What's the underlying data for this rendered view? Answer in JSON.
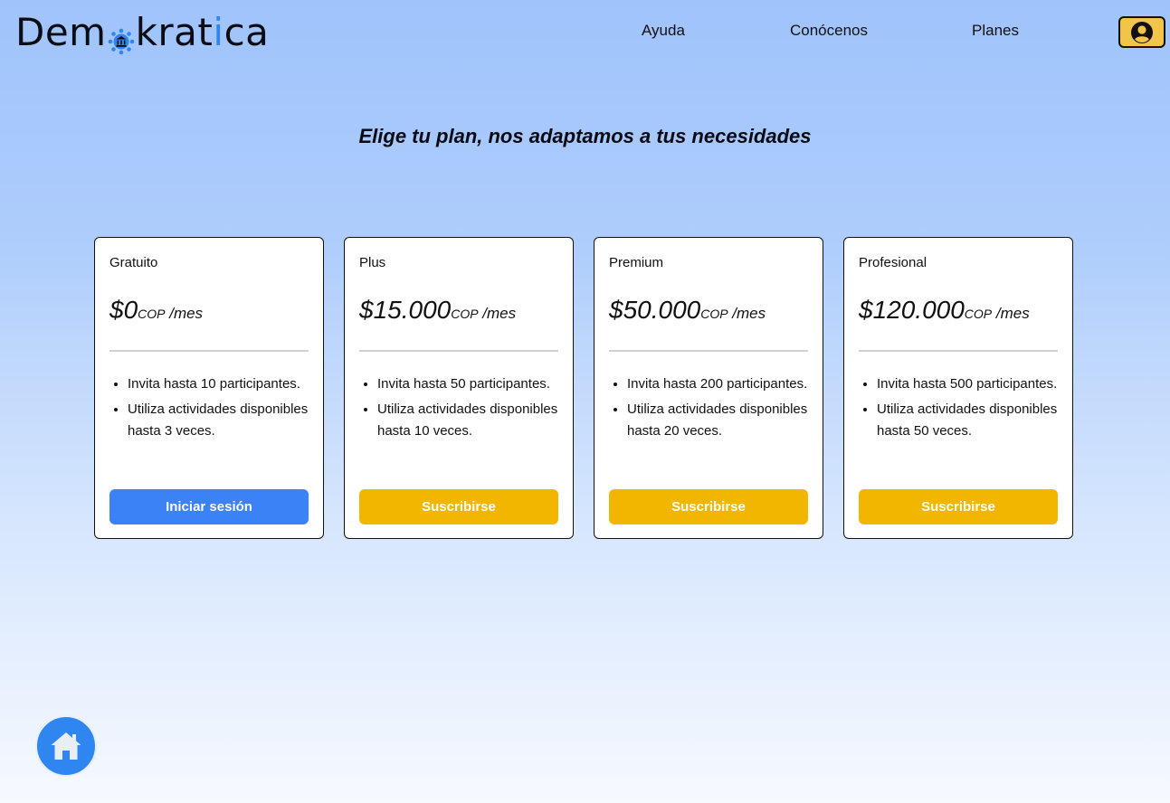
{
  "header": {
    "logo": {
      "part1": "Dem",
      "part2": "krat",
      "part3": "i",
      "part4": "ca"
    },
    "nav": [
      "Ayuda",
      "Conócenos",
      "Planes"
    ],
    "user_icon": "user-circle-icon"
  },
  "title": "Elige tu plan, nos adaptamos a tus necesidades",
  "plans": [
    {
      "name": "Gratuito",
      "price": "$0",
      "currency": "COP",
      "period": " /mes",
      "features": [
        "Invita hasta 10 participantes.",
        "Utiliza actividades disponibles hasta 3 veces."
      ],
      "button": "Iniciar sesión",
      "button_color": "#3b82f6"
    },
    {
      "name": "Plus",
      "price": "$15.000",
      "currency": "COP",
      "period": " /mes",
      "features": [
        "Invita hasta 50 participantes.",
        "Utiliza actividades disponibles hasta 10 veces."
      ],
      "button": "Suscribirse",
      "button_color": "#f2b600"
    },
    {
      "name": "Premium",
      "price": "$50.000",
      "currency": "COP",
      "period": " /mes",
      "features": [
        "Invita hasta 200 participantes.",
        "Utiliza actividades disponibles hasta 20 veces."
      ],
      "button": "Suscribirse",
      "button_color": "#f2b600"
    },
    {
      "name": "Profesional",
      "price": "$120.000",
      "currency": "COP",
      "period": " /mes",
      "features": [
        "Invita hasta 500 participantes.",
        "Utiliza actividades disponibles hasta 50 veces."
      ],
      "button": "Suscribirse",
      "button_color": "#f2b600"
    }
  ],
  "home_icon": "home-icon",
  "colors": {
    "accent_blue": "#3b82f6",
    "accent_yellow": "#f2b600",
    "user_button_bg": "#f2c44a"
  }
}
